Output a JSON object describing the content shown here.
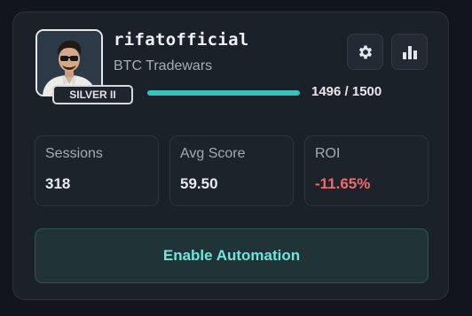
{
  "profile": {
    "username": "rifatofficial",
    "subtitle": "BTC Tradewars",
    "rank_badge": "SILVER II",
    "avatar": "avatar-illustration"
  },
  "progress": {
    "current": 1496,
    "max": 1500,
    "fraction": 0.9973,
    "text": "1496 / 1500"
  },
  "actions": {
    "settings_icon": "gear-icon",
    "stats_icon": "bar-chart-icon"
  },
  "stats": [
    {
      "label": "Sessions",
      "value": "318"
    },
    {
      "label": "Avg Score",
      "value": "59.50"
    },
    {
      "label": "ROI",
      "value": "-11.65%"
    }
  ],
  "automation_button": "Enable Automation",
  "colors": {
    "accent": "#35c4bc",
    "negative": "#ef6b6b",
    "button_text": "#6fe5dc"
  }
}
